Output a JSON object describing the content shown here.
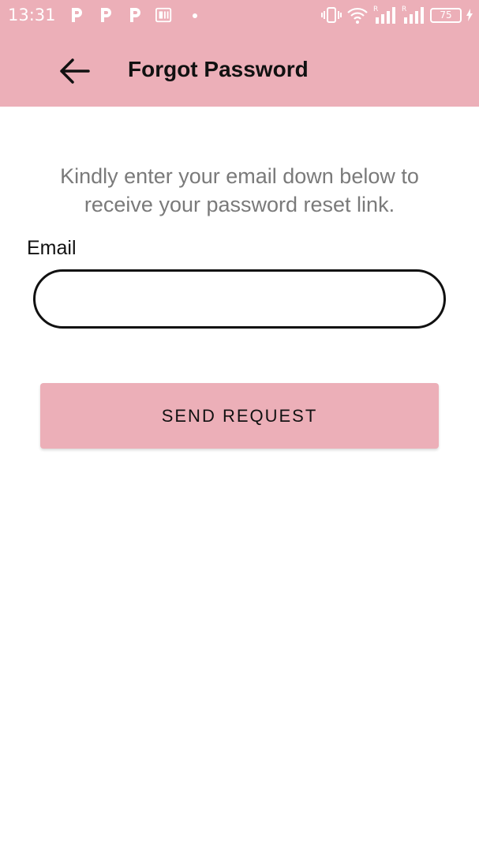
{
  "status_bar": {
    "time": "13:31",
    "notification_icons": [
      "p-app-icon",
      "p-app-icon",
      "p-app-icon",
      "document-app-icon",
      "dot-icon"
    ],
    "system_icons": [
      "vibrate-icon",
      "wifi-icon",
      "signal-r-icon",
      "signal-r-icon",
      "battery-icon",
      "charging-icon"
    ],
    "battery_level": "75"
  },
  "app_bar": {
    "title": "Forgot Password",
    "back_icon": "arrow-left-icon",
    "background_color": "#ecafb8"
  },
  "form": {
    "instructions": "Kindly enter your email down below to\nreceive your password  reset link.",
    "email_label": "Email",
    "email_value": "",
    "email_placeholder": "",
    "submit_label": "SEND REQUEST"
  },
  "colors": {
    "accent": "#ecafb8",
    "text_primary": "#111111",
    "text_secondary": "#7a7a7a"
  }
}
